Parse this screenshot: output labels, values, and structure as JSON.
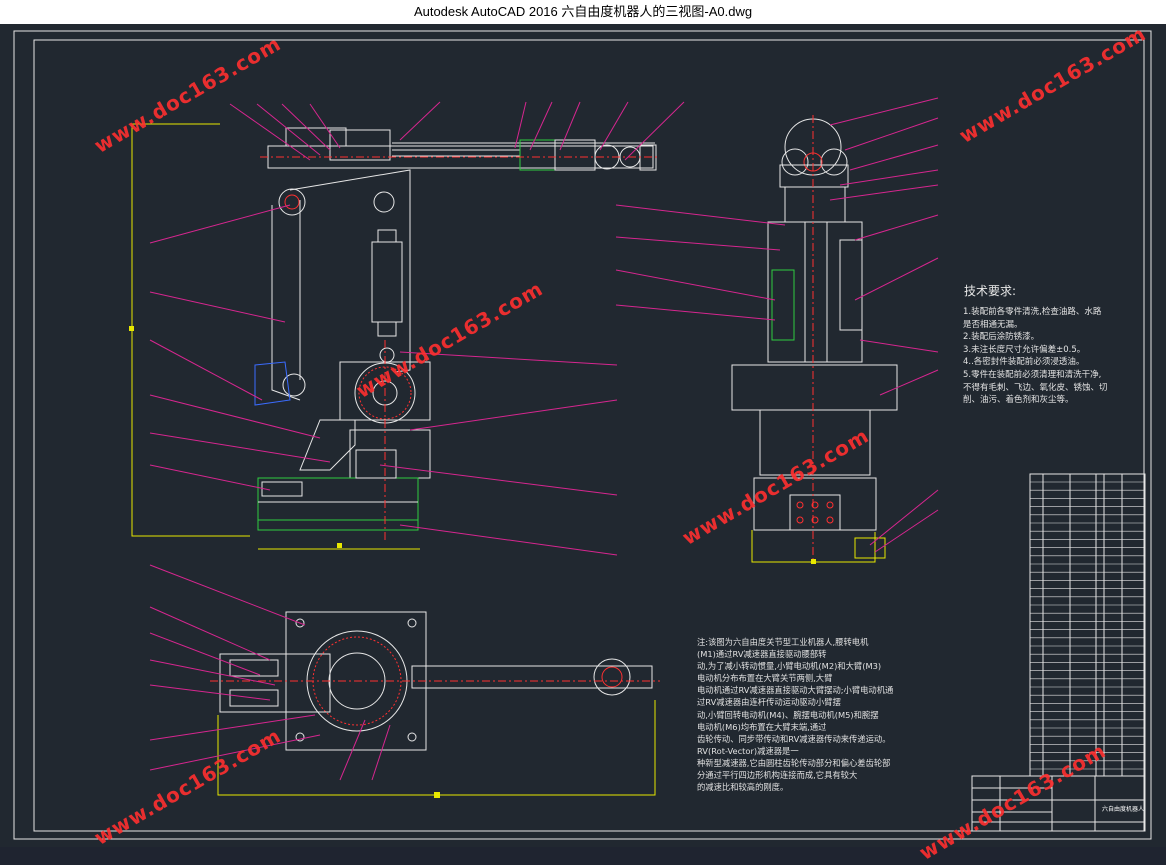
{
  "window": {
    "title": "Autodesk AutoCAD 2016     六自由度机器人的三视图-A0.dwg"
  },
  "watermark": {
    "text": "www.doc163.com"
  },
  "technical_requirements": {
    "title": "技术要求:",
    "lines": [
      "1.装配前各零件清洗,检查油路、水路",
      "是否相通无漏。",
      "2.装配后涂防锈漆。",
      "3.未注长度尺寸允许偏差±0.5。",
      "4..各密封件装配前必须浸透油。",
      "5.零件在装配前必须清理和清洗干净,",
      "不得有毛刺、飞边、氧化皮、锈蚀、切",
      "削、油污、着色剂和灰尘等。"
    ]
  },
  "note": {
    "lines": [
      "    注:该图为六自由度关节型工业机器人,腰转电机",
      "(M1)通过RV减速器直接驱动腰部转",
      "动,为了减小转动惯量,小臂电动机(M2)和大臂(M3)",
      "电动机分布布置在大臂关节两侧,大臂",
      "电动机通过RV减速器直接驱动大臂摆动;小臂电动机通",
      "过RV减速器由连杆传动运动驱动小臂摆",
      "动,小臂回转电动机(M4)、腕摆电动机(M5)和腕摆",
      "电动机(M6)均布置在大臂末端,通过",
      "齿轮传动、同步带传动和RV减速器传动来传递运动。",
      "RV(Rot-Vector)减速器是一",
      "种新型减速器,它由圆柱齿轮传动部分和偏心差齿轮部",
      "分通过平行四边形机构连接而成,它具有较大",
      "的减速比和较高的刚度。"
    ]
  },
  "title_block": {
    "drawing_name": "六自由度机器人"
  },
  "colors": {
    "background": "#212830",
    "lines": "#e6e6e6",
    "leaders": "#d6268f",
    "dimension": "#e8e800",
    "hatch": "#2ecc40",
    "center": "#ff3030",
    "watermark": "#ff2f2f"
  }
}
